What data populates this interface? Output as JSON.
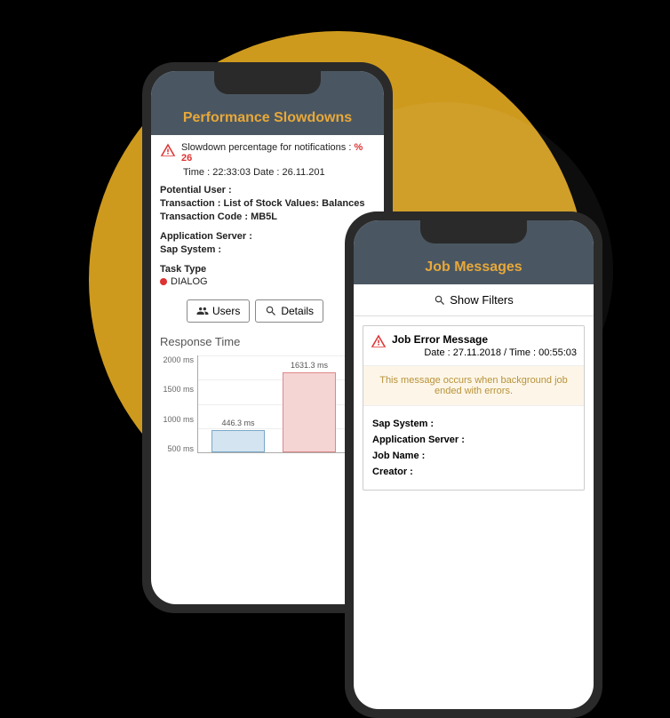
{
  "phone1": {
    "title": "Performance Slowdowns",
    "alert_label": "Slowdown percentage for notifications :",
    "alert_pct": "% 26",
    "time_line": "Time : 22:33:03   Date : 26.11.201",
    "fields": {
      "potential_user": "Potential User :",
      "transaction": "Transaction : List of Stock Values: Balances",
      "transaction_code": "Transaction Code : MB5L",
      "app_server": "Application Server :",
      "sap_system": "Sap System :"
    },
    "task_label": "Task Type",
    "task_value": "DIALOG",
    "buttons": {
      "users": "Users",
      "details": "Details"
    },
    "chart_title": "Response Time"
  },
  "phone2": {
    "title": "Job Messages",
    "show_filters": "Show Filters",
    "card_title": "Job Error Message",
    "card_date": "Date : 27.11.2018 / Time : 00:55:03",
    "card_msg": "This message occurs when background job ended with errors.",
    "fields": {
      "sap_system": "Sap System :",
      "app_server": "Application Server :",
      "job_name": "Job Name :",
      "creator": "Creator :"
    }
  },
  "chart_data": {
    "type": "bar",
    "title": "Response Time",
    "categories": [
      "",
      ""
    ],
    "values": [
      446.3,
      1631.3
    ],
    "series_labels": [
      "446.3 ms",
      "1631.3 ms"
    ],
    "ylabel": "",
    "xlabel": "",
    "ylim": [
      0,
      2000
    ],
    "yticks": [
      "2000 ms",
      "1500 ms",
      "1000 ms",
      "500 ms"
    ]
  }
}
